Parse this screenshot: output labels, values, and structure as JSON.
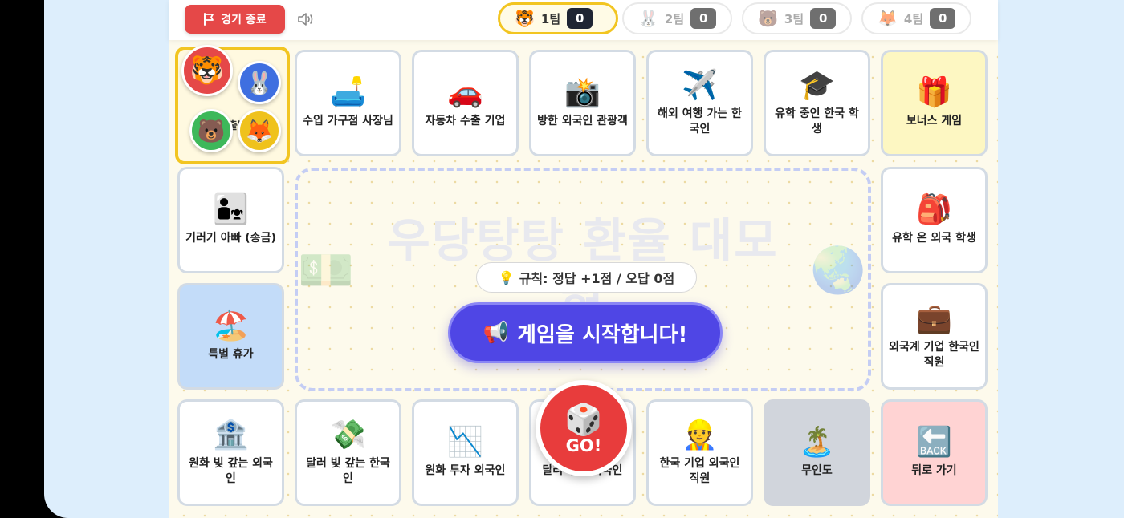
{
  "topbar": {
    "end_label": "경기 종료",
    "teams": [
      {
        "emoji": "🐯",
        "name": "1팀",
        "score": "0",
        "active": true
      },
      {
        "emoji": "🐰",
        "name": "2팀",
        "score": "0",
        "active": false
      },
      {
        "emoji": "🐻",
        "name": "3팀",
        "score": "0",
        "active": false
      },
      {
        "emoji": "🦊",
        "name": "4팀",
        "score": "0",
        "active": false
      }
    ]
  },
  "board": {
    "start_tokens": [
      "🐯",
      "🐰",
      "🐻",
      "🦊"
    ],
    "start_hidden_text": "출발",
    "top": [
      {
        "icon": "🛋️",
        "label": "수입 가구점 사장님"
      },
      {
        "icon": "🚗",
        "label": "자동차 수출 기업"
      },
      {
        "icon": "📸",
        "label": "방한 외국인 관광객"
      },
      {
        "icon": "✈️",
        "label": "해외 여행 가는 한국인"
      },
      {
        "icon": "🎓",
        "label": "유학 중인 한국 학생"
      },
      {
        "icon": "🎁",
        "label": "보너스 게임"
      }
    ],
    "left": [
      {
        "icon": "👨‍👧",
        "label": "기러기 아빠 (송금)"
      },
      {
        "icon": "🏖️",
        "label": "특별 휴가"
      }
    ],
    "right": [
      {
        "icon": "🎒",
        "label": "유학 온 외국 학생"
      },
      {
        "icon": "💼",
        "label": "외국계 기업 한국인 직원"
      }
    ],
    "bottom": [
      {
        "icon": "🏦",
        "label": "원화 빚 갚는 외국인"
      },
      {
        "icon": "💸",
        "label": "달러 빚 갚는 한국인"
      },
      {
        "icon": "📉",
        "label": "원화 투자 외국인"
      },
      {
        "icon": "💵",
        "label": "달러 투자 외국인"
      },
      {
        "icon": "👷",
        "label": "한국 기업 외국인 직원"
      },
      {
        "icon": "🏝️",
        "label": "무인도"
      },
      {
        "icon": "🔙",
        "label": "뒤로 가기"
      }
    ]
  },
  "center": {
    "title": "우당탕탕 환율 대모험",
    "title_left_emoji": "💵",
    "title_right_emoji": "🌏",
    "rule_icon": "💡",
    "rule_text": "규칙: 정답 +1점 / 오답 0점",
    "start_icon": "📢",
    "start_text": "게임을 시작합니다!"
  },
  "go_button": {
    "dice": "🎲",
    "label": "GO!"
  }
}
